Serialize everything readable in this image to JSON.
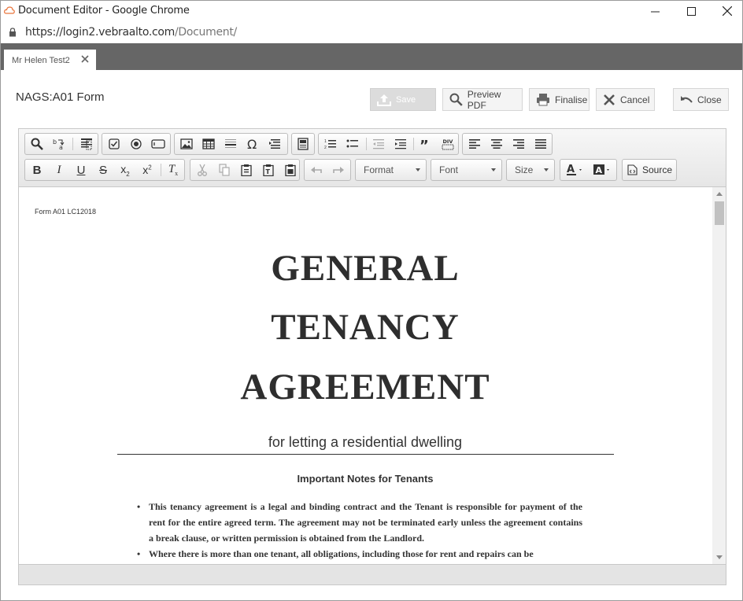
{
  "window": {
    "title": "Document Editor - Google Chrome",
    "url_host": "https://login2.vebraalto.com",
    "url_path": "/Document/"
  },
  "tab": {
    "label": "Mr Helen Test2"
  },
  "header": {
    "form_title": "NAGS:A01 Form",
    "buttons": {
      "save": "Save",
      "preview": "Preview PDF",
      "finalise": "Finalise",
      "cancel": "Cancel",
      "close": "Close"
    }
  },
  "toolbar": {
    "format": "Format",
    "font": "Font",
    "size": "Size",
    "source": "Source"
  },
  "document": {
    "ref": "Form A01 LC12018",
    "heading_lines": [
      "GENERAL",
      "TENANCY",
      "AGREEMENT"
    ],
    "subtitle": "for letting a residential dwelling",
    "notes_title": "Important Notes for Tenants",
    "notes": [
      "This tenancy agreement is a legal and binding contract and the Tenant is responsible for payment of the rent for the entire agreed term. The agreement may not be terminated early unless the agreement contains a break clause, or written permission is obtained from the Landlord.",
      "Where there is more than one tenant, all obligations, including those for rent and repairs can be"
    ]
  },
  "colors": {
    "tabstrip": "#666666",
    "accent_text": "#333333"
  }
}
